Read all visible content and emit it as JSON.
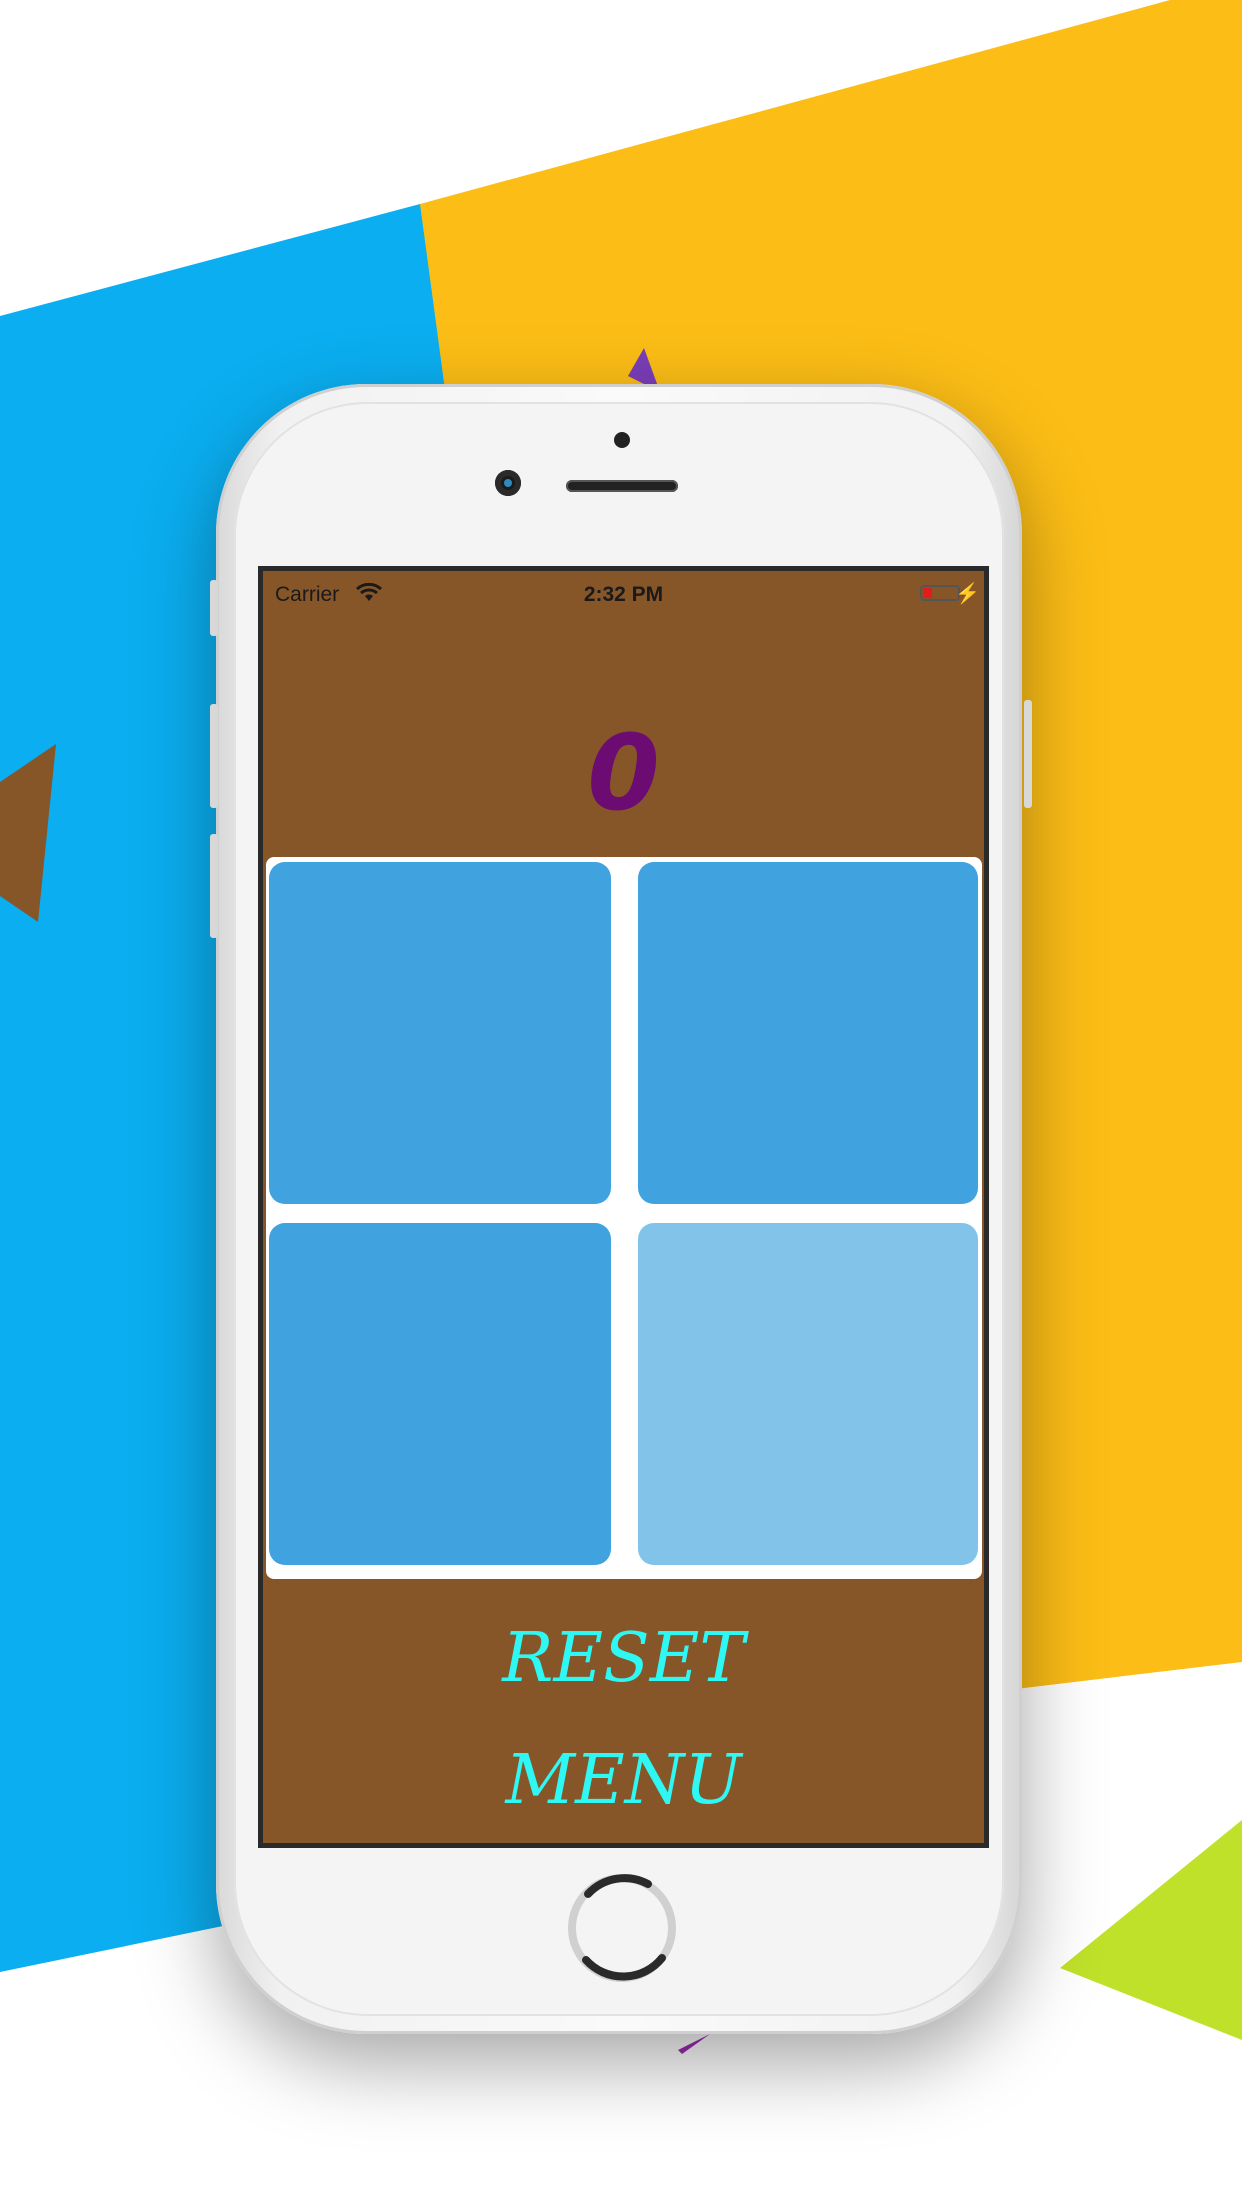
{
  "colors": {
    "bg_blue": "#0baef0",
    "bg_yellow": "#fbbd16",
    "bg_green": "#c0e12a",
    "bg_brown": "#865628",
    "bg_purple": "#7a3eb8",
    "screen_bg": "#865628",
    "score_color": "#6c0c72",
    "tile_dark": "#40a2de",
    "tile_light": "#82c4e9",
    "button_text": "#2ff7f4"
  },
  "status_bar": {
    "carrier": "Carrier",
    "time": "2:32 PM"
  },
  "game": {
    "score": "0",
    "tiles": [
      {
        "state": "dark"
      },
      {
        "state": "dark"
      },
      {
        "state": "dark"
      },
      {
        "state": "light"
      }
    ]
  },
  "buttons": {
    "reset": "RESET",
    "menu": "MENU"
  }
}
